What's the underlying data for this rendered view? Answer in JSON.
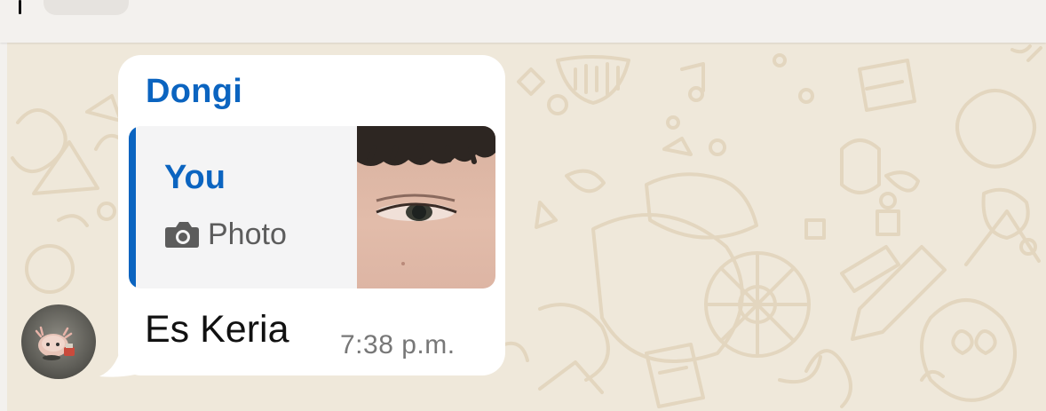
{
  "chat": {
    "message": {
      "sender_name": "Dongi",
      "text": "Es Keria",
      "time": "7:38 p.m.",
      "reply_preview": {
        "author": "You",
        "type_icon": "camera-icon",
        "type_label": "Photo"
      }
    }
  },
  "colors": {
    "accent": "#0b64c0",
    "chat_background": "#efe8da",
    "bubble_background": "#ffffff",
    "quote_background": "#f4f4f5",
    "timestamp": "#777777"
  }
}
